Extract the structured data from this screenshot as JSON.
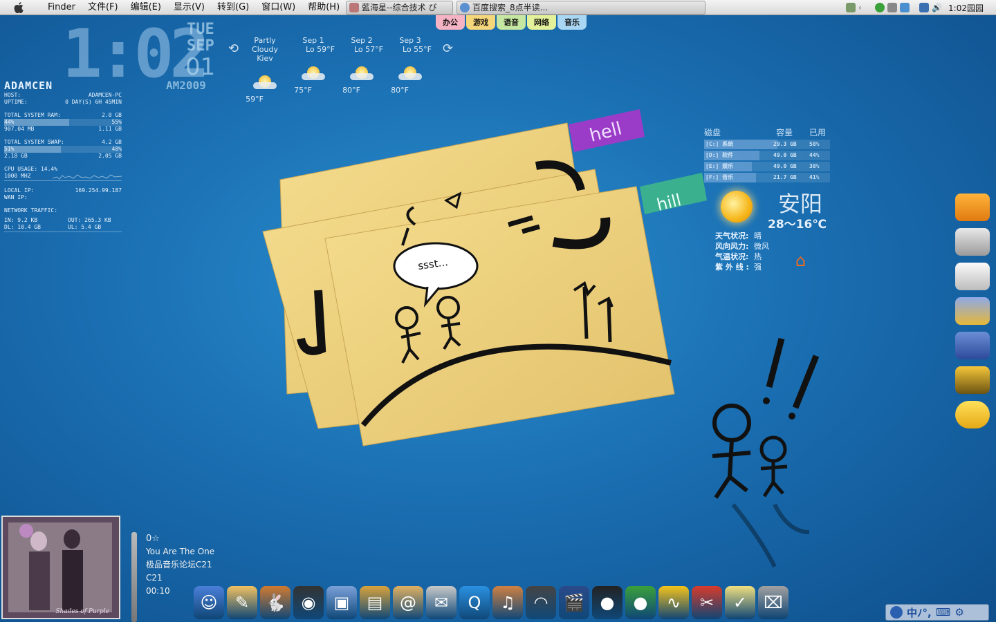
{
  "menubar": {
    "app_name": "Finder",
    "items": [
      "文件(F)",
      "编辑(E)",
      "显示(V)",
      "转到(G)",
      "窗口(W)",
      "帮助(H)"
    ]
  },
  "taskbar": {
    "tasks": [
      {
        "label": "藍海星--综合技术 ぴ"
      },
      {
        "label": "百度搜索_8点半读..."
      }
    ]
  },
  "tray": {
    "time": "1:02园园"
  },
  "tabs": [
    {
      "label": "办公",
      "color": "#f5b3c3"
    },
    {
      "label": "游戏",
      "color": "#f6d67a"
    },
    {
      "label": "语音",
      "color": "#c6e7a1"
    },
    {
      "label": "网络",
      "color": "#e3f19b"
    },
    {
      "label": "音乐",
      "color": "#a9d6f2"
    }
  ],
  "clock": {
    "time": "1:02",
    "day": "TUE",
    "month": "SEP",
    "date": "01",
    "year": "AM2009"
  },
  "sysinfo": {
    "hostname": "ADAMCEN",
    "host_label": "HOST:",
    "host_value": "ADAMCEN-PC",
    "uptime_label": "UPTIME:",
    "uptime_value": "0 DAY(S) 6H 45MIN",
    "ram_label": "TOTAL SYSTEM RAM:",
    "ram_value": "2.0 GB",
    "ram_bar_left": "44%",
    "ram_bar_right": "55%",
    "ram_fill": 0.55,
    "ram_used": "907.04 MB",
    "ram_free": "1.11 GB",
    "swap_label": "TOTAL SYSTEM SWAP:",
    "swap_value": "4.2 GB",
    "swap_bar_left": "51%",
    "swap_bar_right": "48%",
    "swap_fill": 0.48,
    "swap_used": "2.18 GB",
    "swap_free": "2.05 GB",
    "cpu_label": "CPU USAGE: 14.4%",
    "cpu_freq": "1000 MHZ",
    "local_ip_label": "LOCAL IP:",
    "local_ip_value": "169.254.99.187",
    "wan_ip_label": "WAN IP:",
    "net_label": "NETWORK TRAFFIC:",
    "in_label": "IN: 9.2 KB",
    "out_label": "OUT: 265.3 KB",
    "dl_label": "DL: 10.4 GB",
    "ul_label": "UL: 5.4 GB"
  },
  "weather": {
    "days": [
      {
        "head": "Partly Cloudy",
        "sub": "Kiev",
        "temp": "59°F"
      },
      {
        "head": "Sep 1",
        "sub": "Lo 59°F",
        "temp": "75°F"
      },
      {
        "head": "Sep 2",
        "sub": "Lo 57°F",
        "temp": "80°F"
      },
      {
        "head": "Sep 3",
        "sub": "Lo 55°F",
        "temp": "80°F"
      }
    ]
  },
  "notes": {
    "tab1": "hell",
    "tab2": "hill",
    "bubble": "ssst..."
  },
  "disk": {
    "headers": [
      "磁盘",
      "容量",
      "已用"
    ],
    "rows": [
      {
        "name": "[C:] 系统",
        "size": "29.3 GB",
        "used": "58%",
        "fill": 0.58
      },
      {
        "name": "[D:] 软件",
        "size": "49.0 GB",
        "used": "44%",
        "fill": 0.44
      },
      {
        "name": "[E:] 娱乐",
        "size": "49.0 GB",
        "used": "38%",
        "fill": 0.38
      },
      {
        "name": "[F:] 音乐",
        "size": "21.7 GB",
        "used": "41%",
        "fill": 0.41
      }
    ]
  },
  "weather_cn": {
    "city": "安阳",
    "temp": "28～16℃",
    "rows": [
      {
        "k": "天气状况:",
        "v": "晴"
      },
      {
        "k": "风向风力:",
        "v": "微风"
      },
      {
        "k": "气温状况:",
        "v": "热"
      },
      {
        "k": "紫 外 线 :",
        "v": "强"
      }
    ]
  },
  "music": {
    "rating": "0☆",
    "title": "You Are The One",
    "source": "极品音乐论坛C21",
    "album": "C21",
    "time": "00:10",
    "cover_caption": "Shades of Purple"
  },
  "dock": {
    "icons": [
      "finder-icon",
      "notes-icon",
      "rabbit-icon",
      "dashboard-icon",
      "photos-icon",
      "book-icon",
      "address-book-icon",
      "mail-icon",
      "quicktime-icon",
      "guitar-icon",
      "headphones-icon",
      "movie-icon",
      "qq-penguin-icon",
      "duck-icon",
      "activity-icon",
      "tools-icon",
      "notepad-icon",
      "trash-icon"
    ]
  },
  "ime": {
    "text": "中ﾉ°,"
  }
}
